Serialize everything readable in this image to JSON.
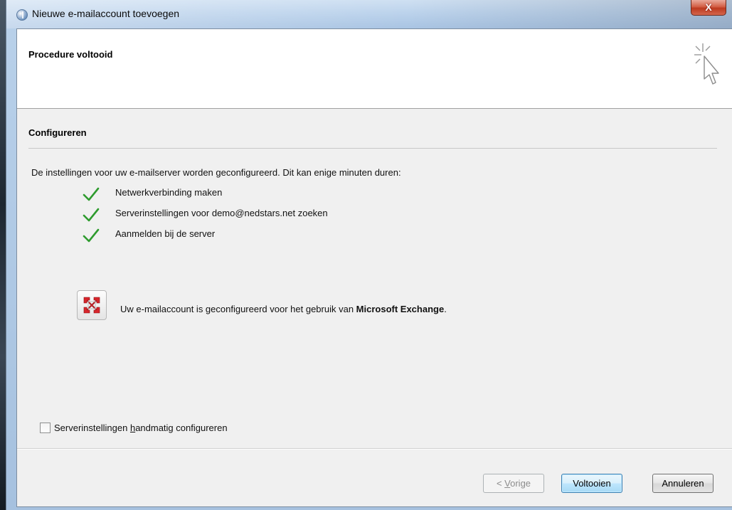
{
  "window": {
    "title": "Nieuwe e-mailaccount toevoegen",
    "close_label": "X"
  },
  "header": {
    "title": "Procedure voltooid"
  },
  "section": {
    "title": "Configureren",
    "intro": "De instellingen voor uw e-mailserver worden geconfigureerd. Dit kan enige minuten duren:"
  },
  "steps": [
    {
      "label": "Netwerkverbinding maken",
      "status": "done"
    },
    {
      "label": "Serverinstellingen voor demo@nedstars.net zoeken",
      "status": "done"
    },
    {
      "label": "Aanmelden bij de server",
      "status": "done"
    }
  ],
  "result": {
    "message_prefix": "Uw e-mailaccount is geconfigureerd voor het gebruik van ",
    "message_bold": "Microsoft Exchange",
    "message_suffix": "."
  },
  "manual_config": {
    "label_before": "Serverinstellingen ",
    "label_accel": "h",
    "label_after": "andmatig configureren",
    "checked": false
  },
  "buttons": {
    "back": {
      "prefix": "< ",
      "accel": "V",
      "rest": "orige"
    },
    "finish": "Voltooien",
    "cancel": "Annuleren"
  },
  "colors": {
    "check_green": "#2e9b2e",
    "exchange_red": "#d8262c"
  },
  "icons": {
    "app": "outlook-globe-icon",
    "wizard": "cursor-sparkle-icon",
    "step_done": "green-checkmark-icon",
    "exchange": "exchange-logo-icon"
  }
}
